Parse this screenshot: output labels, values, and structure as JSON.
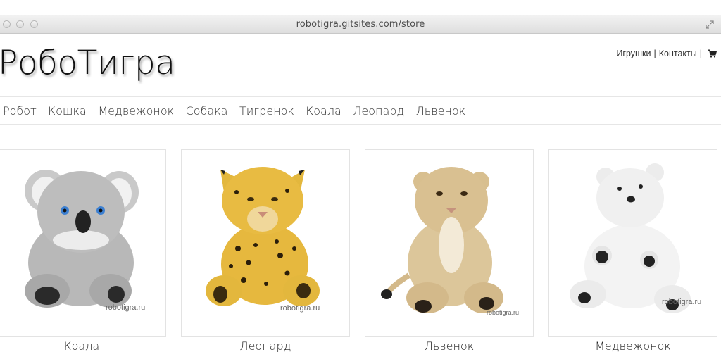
{
  "browser": {
    "url": "robotigra.gitsites.com/store",
    "icons": [
      "close-icon",
      "minimize-icon",
      "zoom-icon",
      "fullscreen-icon"
    ]
  },
  "header": {
    "brand": "РобоТигра",
    "links": [
      {
        "label": "Игрушки"
      },
      {
        "label": "Контакты"
      }
    ],
    "separator": "|",
    "cart_icon": "cart-icon"
  },
  "categories": [
    {
      "label": "Робот"
    },
    {
      "label": "Кошка"
    },
    {
      "label": "Медвежонок"
    },
    {
      "label": "Собака"
    },
    {
      "label": "Тигренок"
    },
    {
      "label": "Коала"
    },
    {
      "label": "Леопард"
    },
    {
      "label": "Львенок"
    }
  ],
  "products": [
    {
      "name": "Коала",
      "watermark": "robotigra.ru"
    },
    {
      "name": "Леопард",
      "watermark": "robotigra.ru"
    },
    {
      "name": "Львенок",
      "watermark": "robotigra.ru"
    },
    {
      "name": "Медвежонок",
      "watermark": "robotigra.ru"
    }
  ]
}
